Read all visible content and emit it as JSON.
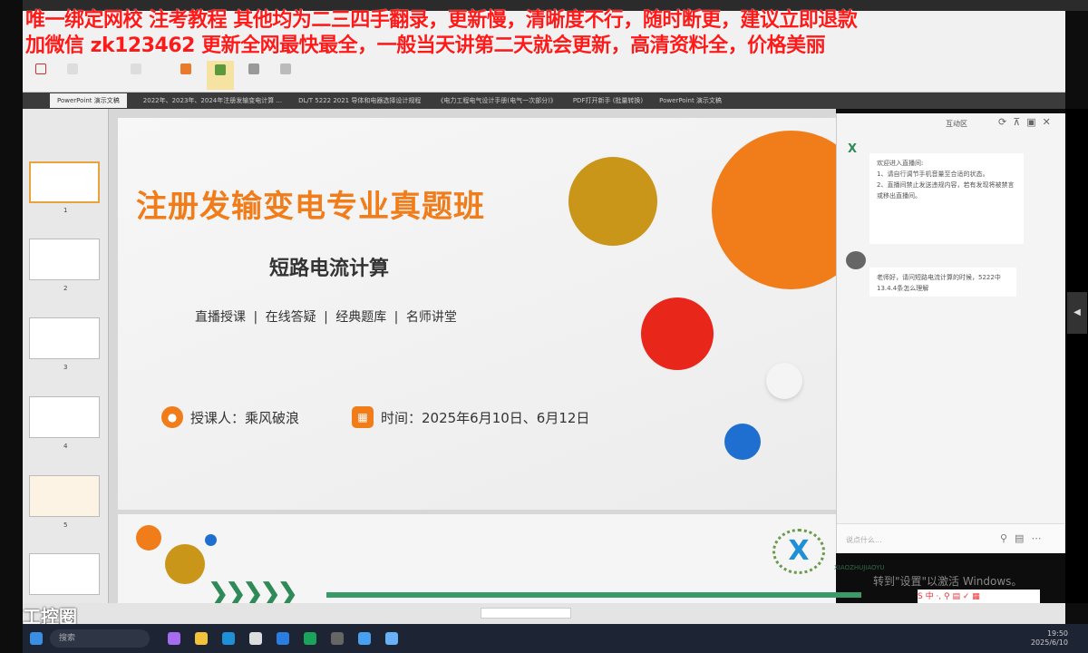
{
  "overlay": {
    "line1": "唯一绑定网校 注考教程 其他均为二三四手翻录，更新慢，清晰度不行，随时断更，建议立即退款",
    "line2": "加微信 zk123462 更新全网最快最全，一般当天讲第二天就会更新，高清资料全，价格美丽"
  },
  "tabs": [
    "PowerPoint 演示文稿",
    "2022年、2023年、2024年注册发输变电计算 ...",
    "DL/T 5222 2021 导体和电器选择设计规程",
    "《电力工程电气设计手册(电气一次部分)》",
    "PDF打开新手 (批量转换)",
    "PowerPoint 演示文稿"
  ],
  "slide": {
    "title": "注册发输变电专业真题班",
    "subtitle": "短路电流计算",
    "tags": "直播授课 | 在线答疑 | 经典题库 | 名师讲堂",
    "lecturer": "授课人：乘风破浪",
    "time": "时间：2025年6月10日、6月12日",
    "logo_text": "XIAOZHUJIAOYU"
  },
  "thumbnails": [
    "1",
    "2",
    "3",
    "4",
    "5"
  ],
  "chat": {
    "title": "互动区",
    "welcome": [
      "欢迎进入直播间:",
      "1、请自行调节手机音量至合适的状态。",
      "2、直播间禁止发送违规内容，若有发现将被禁言或移出直播间。"
    ],
    "question": "老师好，请问短路电流计算的时候，5222中13.4.4条怎么理解",
    "input_placeholder": "说点什么..."
  },
  "watermark": "转到\"设置\"以激活 Windows。",
  "bottom_logo": "工控圈",
  "taskbar": {
    "search": "搜索",
    "time": "19:50",
    "date": "2025/6/10"
  },
  "colors": {
    "orange": "#f07c1a",
    "gold": "#c9961a",
    "red": "#e8261a",
    "blue": "#1f6fd1",
    "overlay": "#ff1a1a"
  }
}
